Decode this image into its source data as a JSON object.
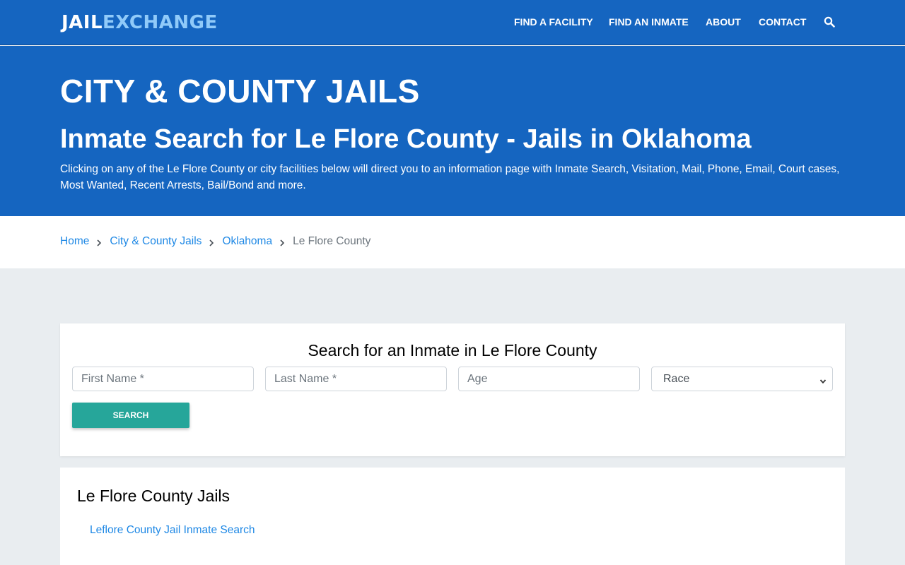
{
  "brand": {
    "part1": "JAIL",
    "part2": "EXCHANGE"
  },
  "nav": {
    "items": [
      "FIND A FACILITY",
      "FIND AN INMATE",
      "ABOUT",
      "CONTACT"
    ],
    "search_icon": "search-icon"
  },
  "hero": {
    "kicker": "CITY & COUNTY JAILS",
    "title": "Inmate Search for Le Flore County - Jails in Oklahoma",
    "description": "Clicking on any of the Le Flore County or city facilities below will direct you to an information page with Inmate Search, Visitation, Mail, Phone, Email, Court cases, Most Wanted, Recent Arrests, Bail/Bond and more."
  },
  "breadcrumb": {
    "items": [
      "Home",
      "City & County Jails",
      "Oklahoma"
    ],
    "current": "Le Flore County",
    "separator_icon": "chevron-right-icon"
  },
  "search_form": {
    "title": "Search for an Inmate in Le Flore County",
    "first_name_placeholder": "First Name *",
    "last_name_placeholder": "Last Name *",
    "age_placeholder": "Age",
    "race_selected": "Race",
    "submit_label": "SEARCH"
  },
  "jails": {
    "title": "Le Flore County Jails",
    "links": [
      "Leflore County Jail Inmate Search"
    ]
  },
  "colors": {
    "primary": "#1565c0",
    "logo_accent": "#90caf9",
    "link": "#1e88e5",
    "button": "#26a69a",
    "page_bg": "#e9edf0"
  }
}
